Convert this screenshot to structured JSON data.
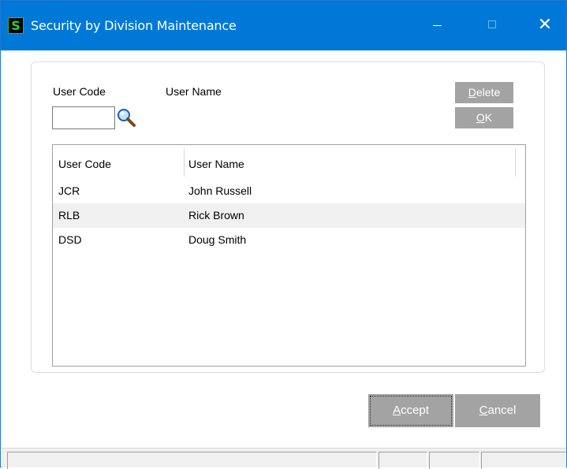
{
  "window": {
    "title": "Security by Division Maintenance",
    "app_icon_letter": "S",
    "min_glyph": "",
    "close_glyph": "✕"
  },
  "form": {
    "user_code_label": "User Code",
    "user_name_label": "User Name",
    "user_code_value": "",
    "user_name_value": "",
    "lookup_icon": "magnifier-icon"
  },
  "buttons": {
    "delete": {
      "hotkey": "D",
      "rest": "elete"
    },
    "ok": {
      "hotkey": "O",
      "rest": "K"
    },
    "accept": {
      "hotkey": "A",
      "rest": "ccept"
    },
    "cancel": {
      "hotkey": "C",
      "rest": "ancel"
    }
  },
  "list": {
    "columns": [
      "User Code",
      "User Name"
    ],
    "rows": [
      {
        "code": "JCR",
        "name": "John Russell"
      },
      {
        "code": "RLB",
        "name": "Rick Brown"
      },
      {
        "code": "DSD",
        "name": "Doug Smith"
      }
    ]
  },
  "colors": {
    "titlebar": "#0078d7",
    "button_gray": "#a3a3a3",
    "row_alt": "#f0f0f0"
  }
}
